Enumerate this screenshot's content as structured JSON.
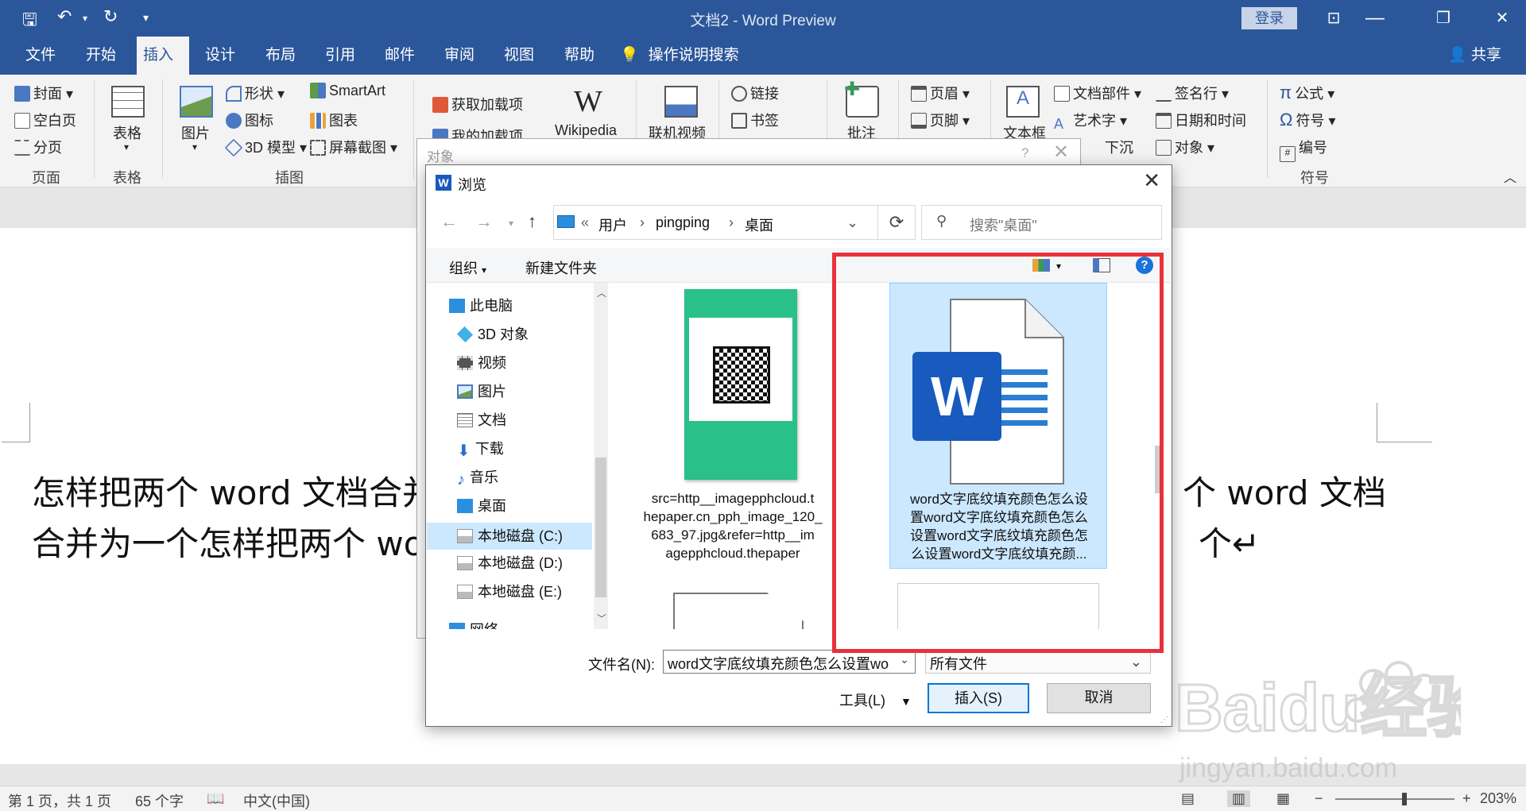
{
  "window": {
    "title": "文档2  -  Word Preview",
    "login": "登录"
  },
  "tabs": [
    "文件",
    "开始",
    "插入",
    "设计",
    "布局",
    "引用",
    "邮件",
    "审阅",
    "视图",
    "帮助"
  ],
  "active_tab": "插入",
  "tell_me": "操作说明搜索",
  "share": "共享",
  "ribbon": {
    "pages": {
      "cover": "封面",
      "blank": "空白页",
      "break": "分页",
      "label": "页面"
    },
    "table": {
      "table": "表格",
      "label": "表格"
    },
    "illustrations": {
      "picture": "图片",
      "shapes": "形状",
      "icons": "图标",
      "model3d": "3D 模型",
      "smartart": "SmartArt",
      "chart": "图表",
      "screenshot": "屏幕截图",
      "label": "插图"
    },
    "addins": {
      "get": "获取加载项",
      "mine": "我的加载项",
      "wiki": "Wikipedia"
    },
    "media": {
      "online_video": "联机视频"
    },
    "links": {
      "link": "链接",
      "bookmark": "书签"
    },
    "comments": {
      "comment": "批注"
    },
    "header_footer": {
      "header": "页眉",
      "footer": "页脚"
    },
    "text": {
      "textbox": "文本框",
      "quickparts": "文档部件",
      "wordart": "艺术字",
      "dropcap": "下沉",
      "signature": "签名行",
      "datetime": "日期和时间",
      "object": "对象"
    },
    "symbols": {
      "equation": "公式",
      "symbol": "符号",
      "number": "编号",
      "label": "符号"
    }
  },
  "document": {
    "line1_left": "怎样把两个 word 文档合并",
    "line1_right": "个 word 文档",
    "line2_left": "合并为一个怎样把两个 wo",
    "line2_right": "个↵"
  },
  "status": {
    "page": "第 1 页，共 1 页",
    "words": "65 个字",
    "lang": "中文(中国)",
    "zoom": "203%"
  },
  "object_dialog": {
    "title": "对象",
    "help": "?"
  },
  "browse": {
    "title": "浏览",
    "breadcrumb": [
      "用户",
      "pingping",
      "桌面"
    ],
    "search_placeholder": "搜索\"桌面\"",
    "organize": "组织",
    "new_folder": "新建文件夹",
    "nav": [
      "此电脑",
      "3D 对象",
      "视频",
      "图片",
      "文档",
      "下载",
      "音乐",
      "桌面",
      "本地磁盘 (C:)",
      "本地磁盘 (D:)",
      "本地磁盘 (E:)",
      "网络"
    ],
    "selected_nav": "本地磁盘 (C:)",
    "files": [
      {
        "name": "src=http__imagepphcloud.thepaper.cn_pph_image_120_683_97.jpg&refer=http__imagepphcloud.thepaper",
        "lines": [
          "src=http__imagepphcloud.t",
          "hepaper.cn_pph_image_120_",
          "683_97.jpg&refer=http__im",
          "agepphcloud.thepaper"
        ]
      },
      {
        "name": "word文字底纹填充颜色怎么设置",
        "lines": [
          "word文字底纹填充颜色怎么设",
          "置word文字底纹填充颜色怎么",
          "设置word文字底纹填充颜色怎",
          "么设置word文字底纹填充颜..."
        ]
      }
    ],
    "filename_label": "文件名(N):",
    "filename_value": "word文字底纹填充颜色怎么设置wo",
    "filetype": "所有文件",
    "tools": "工具(L)",
    "insert": "插入(S)",
    "cancel": "取消"
  },
  "colors": {
    "brand": "#2b579a",
    "highlight": "#e8313a",
    "selection": "#cce8ff",
    "word_blue": "#185abd"
  },
  "watermark": {
    "text": "Baidu经验",
    "sub": "jingyan.baidu.com"
  }
}
